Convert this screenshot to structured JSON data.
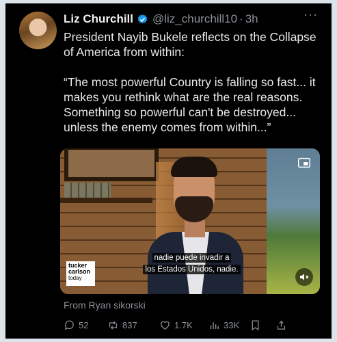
{
  "tweet": {
    "author_name": "Liz Churchill",
    "handle": "@liz_churchill10",
    "separator": "·",
    "time": "3h",
    "more_label": "···",
    "text_line1": "President Nayib Bukele reflects on the Collapse of America from within:",
    "text_line2": "“The most powerful Country is falling so fast... it makes you rethink what are the real reasons. Something so powerful can't be destroyed... unless the enemy comes from within...”",
    "verified_color": "#1d9bf0"
  },
  "media": {
    "logo": [
      "tucker",
      "carlson",
      "today"
    ],
    "subtitle_line1": "nadie puede invadir a",
    "subtitle_line2": "los Estados Unidos, nadie.",
    "icons": [
      "picture-in-picture-icon",
      "mute-icon"
    ]
  },
  "attribution": "From Ryan sikorski",
  "actions": {
    "replies": "52",
    "reposts": "837",
    "likes": "1.7K",
    "views": "33K"
  },
  "colors": {
    "background": "#000000",
    "text": "#e7e9ea",
    "secondary": "#8b9096",
    "page": "#dde3ea"
  }
}
